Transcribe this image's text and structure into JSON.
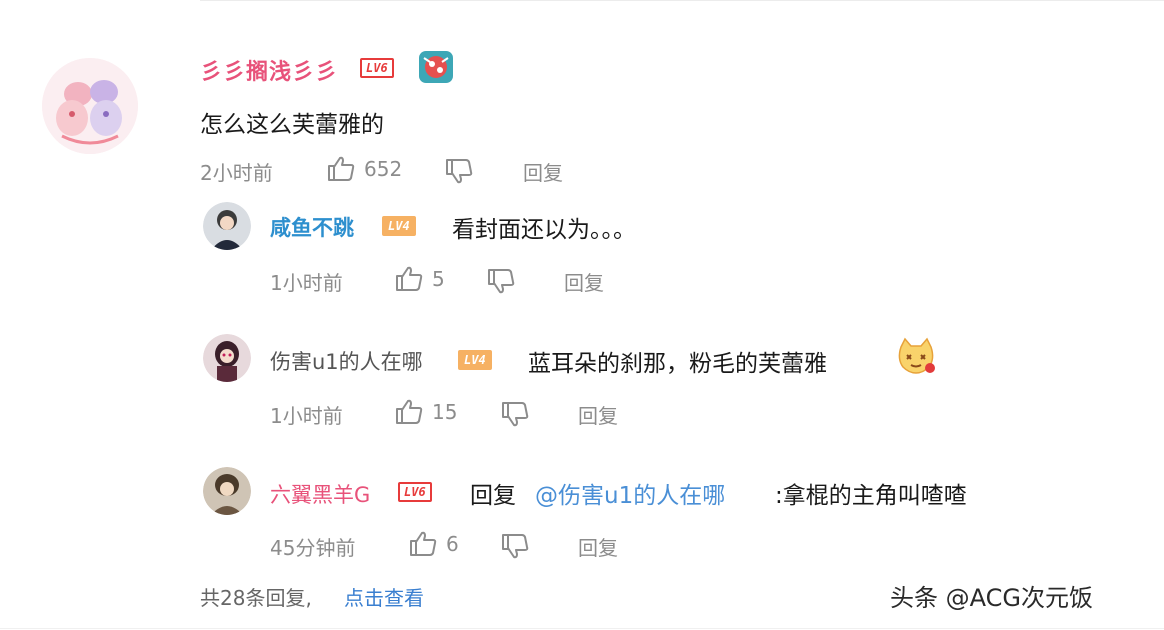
{
  "comments": [
    {
      "username": "彡彡搁浅彡彡",
      "level": "LV6",
      "text": "怎么这么芙蕾雅的",
      "time": "2小时前",
      "likes": "652",
      "reply_label": "回复",
      "replies": [
        {
          "username": "咸鱼不跳",
          "level": "LV4",
          "text": "看封面还以为。。。",
          "time": "1小时前",
          "likes": "5",
          "reply_label": "回复"
        },
        {
          "username": "伤害u1的人在哪",
          "level": "LV4",
          "text": "蓝耳朵的刹那，粉毛的芙蕾雅",
          "time": "1小时前",
          "likes": "15",
          "reply_label": "回复"
        },
        {
          "username": "六翼黑羊G",
          "level": "LV6",
          "reply_prefix": "回复",
          "mention": "@伤害u1的人在哪",
          "text": ":拿棍的主角叫喳喳",
          "time": "45分钟前",
          "likes": "6",
          "reply_label": "回复"
        }
      ]
    }
  ],
  "footer": {
    "count_text": "共28条回复,",
    "view_link": "点击查看"
  },
  "watermark": "头条 @ACG次元饭",
  "colors": {
    "top_username": "#e8527a",
    "reply_username_1": "#2d8fce",
    "reply_username_2": "#555555",
    "reply_username_3": "#e8527a",
    "mention": "#4a8fd6",
    "meta_gray": "#8c8c8c"
  },
  "icons": [
    "thumbs-up-icon",
    "thumbs-down-icon",
    "badge-icon",
    "cat-emoji-icon"
  ]
}
